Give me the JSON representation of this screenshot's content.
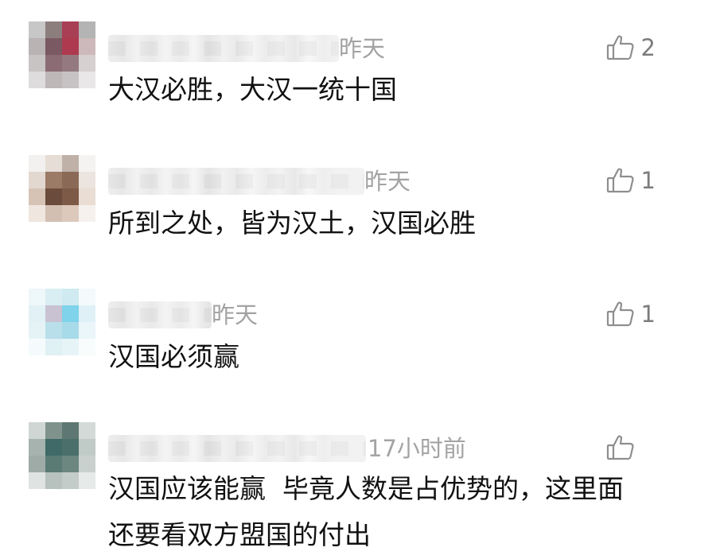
{
  "comments": [
    {
      "time": "昨天",
      "likes": "2",
      "text": "大汉必胜，大汉一统十国",
      "avatar_colors": [
        "#c7c7c7",
        "#8d7e7e",
        "#a83f55",
        "#b4b4b4",
        "#b9b3b3",
        "#7a5962",
        "#ad3a4e",
        "#cdb9bb",
        "#c8c4c4",
        "#8c6c74",
        "#947a80",
        "#d6d0d1",
        "#dedcdc",
        "#bdb7b8",
        "#c7c3c4",
        "#e9e7e7"
      ]
    },
    {
      "time": "昨天",
      "likes": "1",
      "text": "所到之处，皆为汉土，汉国必胜",
      "avatar_colors": [
        "#f3f1ef",
        "#e6ddd6",
        "#bfb1a8",
        "#f5f3f1",
        "#e3d8d0",
        "#9b7a66",
        "#8a6a57",
        "#ece4de",
        "#d6c3b6",
        "#6b4c3c",
        "#7d5a47",
        "#e9ddd4",
        "#efe6df",
        "#d3bfb2",
        "#dcc9bc",
        "#f6f1ee"
      ]
    },
    {
      "time": "昨天",
      "likes": "1",
      "text": "汉国必须赢",
      "avatar_colors": [
        "#eef7f9",
        "#d8eef3",
        "#cfeaf1",
        "#f4fafb",
        "#e2f1f5",
        "#c9c2d3",
        "#7fd3ea",
        "#dff1f6",
        "#e6f3f6",
        "#b8dfea",
        "#a8dbe9",
        "#eaf6f9",
        "#f5fbfc",
        "#e0f1f5",
        "#e7f4f7",
        "#f8fcfd"
      ]
    },
    {
      "time": "17小时前",
      "likes": "",
      "text": "汉国应该能赢  毕竟人数是占优势的，这里面\n还要看双方盟国的付出",
      "avatar_colors": [
        "#cfd6d3",
        "#7f938c",
        "#5f7772",
        "#d4dad8",
        "#a6b3ae",
        "#3f6a67",
        "#4b706c",
        "#c0cac7",
        "#9eaba6",
        "#5a7a74",
        "#6b8780",
        "#c9d1ce",
        "#dfe4e2",
        "#b7c2be",
        "#c4ccc9",
        "#e6eae8"
      ]
    }
  ],
  "icons": {
    "like": "thumbs-up-outline-icon"
  }
}
